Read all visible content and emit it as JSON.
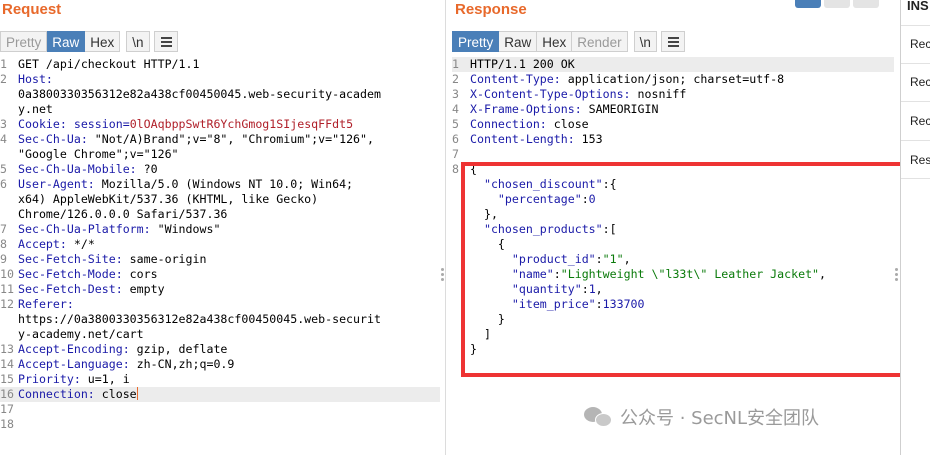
{
  "request": {
    "title": "Request",
    "tabs": [
      {
        "label": "Pretty",
        "state": "muted"
      },
      {
        "label": "Raw",
        "state": "active"
      },
      {
        "label": "Hex",
        "state": "normal"
      }
    ],
    "newline_toggle": "\\n",
    "lines": [
      {
        "n": "1",
        "text": "GET /api/checkout HTTP/1.1"
      },
      {
        "n": "2",
        "key": "Host:",
        "text": ""
      },
      {
        "n": "",
        "text": "0a3800330356312e82a438cf00450045.web-security-academ"
      },
      {
        "n": "",
        "text": "y.net"
      },
      {
        "n": "3",
        "key": "Cookie: ",
        "keyb": "session=",
        "val": "0lOAqbppSwtR6YchGmog1SIjesqFFdt5"
      },
      {
        "n": "4",
        "key": "Sec-Ch-Ua:",
        "text": " \"Not/A)Brand\";v=\"8\", \"Chromium\";v=\"126\","
      },
      {
        "n": "",
        "text": "\"Google Chrome\";v=\"126\""
      },
      {
        "n": "5",
        "key": "Sec-Ch-Ua-Mobile:",
        "text": " ?0"
      },
      {
        "n": "6",
        "key": "User-Agent:",
        "text": " Mozilla/5.0 (Windows NT 10.0; Win64;"
      },
      {
        "n": "",
        "text": "x64) AppleWebKit/537.36 (KHTML, like Gecko)"
      },
      {
        "n": "",
        "text": "Chrome/126.0.0.0 Safari/537.36"
      },
      {
        "n": "7",
        "key": "Sec-Ch-Ua-Platform:",
        "text": " \"Windows\""
      },
      {
        "n": "8",
        "key": "Accept:",
        "text": " */*"
      },
      {
        "n": "9",
        "key": "Sec-Fetch-Site:",
        "text": " same-origin"
      },
      {
        "n": "10",
        "key": "Sec-Fetch-Mode:",
        "text": " cors"
      },
      {
        "n": "11",
        "key": "Sec-Fetch-Dest:",
        "text": " empty"
      },
      {
        "n": "12",
        "key": "Referer:",
        "text": ""
      },
      {
        "n": "",
        "text": "https://0a3800330356312e82a438cf00450045.web-securit"
      },
      {
        "n": "",
        "text": "y-academy.net/cart"
      },
      {
        "n": "13",
        "key": "Accept-Encoding:",
        "text": " gzip, deflate"
      },
      {
        "n": "14",
        "key": "Accept-Language:",
        "text": " zh-CN,zh;q=0.9"
      },
      {
        "n": "15",
        "key": "Priority:",
        "text": " u=1, i"
      },
      {
        "n": "16",
        "key": "Connection:",
        "text": " close",
        "highlight": true,
        "caret": true
      },
      {
        "n": "17",
        "text": ""
      },
      {
        "n": "18",
        "text": ""
      }
    ]
  },
  "response": {
    "title": "Response",
    "tabs": [
      {
        "label": "Pretty",
        "state": "active"
      },
      {
        "label": "Raw",
        "state": "normal"
      },
      {
        "label": "Hex",
        "state": "normal"
      },
      {
        "label": "Render",
        "state": "muted"
      }
    ],
    "newline_toggle": "\\n",
    "lines": [
      {
        "n": "1",
        "text": "HTTP/1.1 200 OK",
        "highlight": true
      },
      {
        "n": "2",
        "key": "Content-Type:",
        "text": " application/json; charset=utf-8"
      },
      {
        "n": "3",
        "key": "X-Content-Type-Options:",
        "text": " nosniff"
      },
      {
        "n": "4",
        "key": "X-Frame-Options:",
        "text": " SAMEORIGIN"
      },
      {
        "n": "5",
        "key": "Connection:",
        "text": " close"
      },
      {
        "n": "6",
        "key": "Content-Length:",
        "text": " 153"
      },
      {
        "n": "7",
        "text": ""
      },
      {
        "n": "8",
        "text": "{"
      },
      {
        "n": "",
        "indent": "  ",
        "jk": "\"chosen_discount\"",
        "text": ":{"
      },
      {
        "n": "",
        "indent": "    ",
        "jk": "\"percentage\"",
        "text": ":",
        "jn": "0"
      },
      {
        "n": "",
        "indent": "  ",
        "text": "},"
      },
      {
        "n": "",
        "indent": "  ",
        "jk": "\"chosen_products\"",
        "text": ":["
      },
      {
        "n": "",
        "indent": "    ",
        "text": "{"
      },
      {
        "n": "",
        "indent": "      ",
        "jk": "\"product_id\"",
        "text": ":",
        "js": "\"1\"",
        "tail": ","
      },
      {
        "n": "",
        "indent": "      ",
        "jk": "\"name\"",
        "text": ":",
        "js": "\"Lightweight \\\"l33t\\\" Leather Jacket\"",
        "tail": ","
      },
      {
        "n": "",
        "indent": "      ",
        "jk": "\"quantity\"",
        "text": ":",
        "jn": "1",
        "tail": ","
      },
      {
        "n": "",
        "indent": "      ",
        "jk": "\"item_price\"",
        "text": ":",
        "jn": "133700"
      },
      {
        "n": "",
        "indent": "    ",
        "text": "}"
      },
      {
        "n": "",
        "indent": "  ",
        "text": "]"
      },
      {
        "n": "",
        "text": "}"
      }
    ]
  },
  "inspector": {
    "title": "INS",
    "items": [
      "Rec",
      "Rec",
      "Rec",
      "Res"
    ]
  },
  "watermark": {
    "text": "公众号 · SecNL安全团队"
  },
  "colors": {
    "accent": "#e8692b",
    "active_tab": "#4a7fb8",
    "annotation_box": "#ee3333"
  }
}
